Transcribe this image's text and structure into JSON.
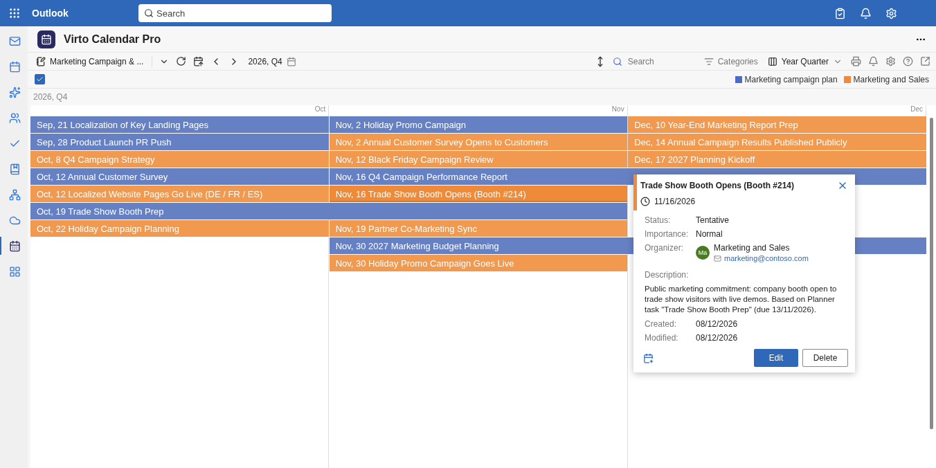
{
  "topbar": {
    "app_name": "Outlook",
    "search": {
      "placeholder": "Search"
    }
  },
  "rail": [
    {
      "selected": false
    },
    {
      "selected": false
    },
    {
      "selected": false
    },
    {
      "selected": false
    },
    {
      "selected": false
    },
    {
      "selected": false
    },
    {
      "selected": false
    },
    {
      "selected": false
    },
    {
      "selected": true
    },
    {
      "selected": false
    }
  ],
  "app": {
    "title": "Virto Calendar Pro"
  },
  "toolbar": {
    "calendar_name": "Marketing Campaign & ...",
    "period": "2026, Q4",
    "search": {
      "placeholder": "Search"
    },
    "categories": "Categories",
    "view": "Year Quarter"
  },
  "select_all": {
    "checked": true
  },
  "legend": [
    {
      "label": "Marketing campaign plan",
      "color": "#4a6cc4"
    },
    {
      "label": "Marketing and Sales",
      "color": "#f08a3a"
    }
  ],
  "period_label": "2026, Q4",
  "months": [
    "Oct",
    "Nov",
    "Dec"
  ],
  "rows": [
    {
      "events": [
        {
          "kind": "single",
          "label": "Sep, 21 Localization of Key Landing Pages",
          "color": "#6680c4",
          "selected": false
        },
        {
          "kind": "single",
          "label": "Nov, 2 Holiday Promo Campaign",
          "color": "#6680c4",
          "selected": false
        },
        {
          "kind": "single",
          "label": "Dec, 10 Year-End Marketing Report Prep",
          "color": "#f0994f",
          "selected": false
        }
      ]
    },
    {
      "events": [
        {
          "kind": "single",
          "label": "Sep, 28 Product Launch PR Push",
          "color": "#6680c4",
          "selected": false
        },
        {
          "kind": "single",
          "label": "Nov, 2 Annual Customer Survey Opens to Customers",
          "color": "#f0994f",
          "selected": false
        },
        {
          "kind": "single",
          "label": "Dec, 14 Annual Campaign Results Published Publicly",
          "color": "#f0994f",
          "selected": false
        }
      ]
    },
    {
      "events": [
        {
          "kind": "single",
          "label": "Oct, 8 Q4 Campaign Strategy",
          "color": "#f0994f",
          "selected": false
        },
        {
          "kind": "single",
          "label": "Nov, 12 Black Friday Campaign Review",
          "color": "#f0994f",
          "selected": false
        },
        {
          "kind": "single",
          "label": "Dec, 17 2027 Planning Kickoff",
          "color": "#f0994f",
          "selected": false
        }
      ]
    },
    {
      "events": [
        {
          "kind": "single",
          "label": "Oct, 12 Annual Customer Survey",
          "color": "#6680c4",
          "selected": false
        },
        {
          "kind": "double",
          "label": "Nov, 16 Q4 Campaign Performance Report",
          "color": "#6680c4",
          "selected": false
        }
      ]
    },
    {
      "events": [
        {
          "kind": "single",
          "label": "Oct, 12 Localized Website Pages Go Live (DE / FR / ES)",
          "color": "#f0994f",
          "selected": false
        },
        {
          "kind": "single",
          "label": "Nov, 16 Trade Show Booth Opens (Booth #214)",
          "color": "#ee8a38",
          "selected": true
        }
      ]
    },
    {
      "events": [
        {
          "kind": "double",
          "label": "Oct, 19 Trade Show Booth Prep",
          "color": "#6680c4",
          "selected": false
        }
      ]
    },
    {
      "events": [
        {
          "kind": "single",
          "label": "Oct, 22 Holiday Campaign Planning",
          "color": "#f0994f",
          "selected": false
        },
        {
          "kind": "single",
          "label": "Nov, 19 Partner Co-Marketing Sync",
          "color": "#f0994f",
          "selected": false
        }
      ]
    },
    {
      "events": [
        {
          "kind": "gap"
        },
        {
          "kind": "double",
          "label": "Nov, 30 2027 Marketing Budget Planning",
          "color": "#6680c4",
          "selected": false
        }
      ]
    },
    {
      "events": [
        {
          "kind": "gap"
        },
        {
          "kind": "single",
          "label": "Nov, 30 Holiday Promo Campaign Goes Live",
          "color": "#f0994f",
          "selected": false
        }
      ]
    }
  ],
  "popup": {
    "title": "Trade Show Booth Opens (Booth #214)",
    "color": "#f08a3a",
    "date": "11/16/2026",
    "fields": [
      {
        "label": "Status:",
        "value": "Tentative"
      },
      {
        "label": "Importance:",
        "value": "Normal"
      }
    ],
    "organizer": {
      "label": "Organizer:",
      "initials": "Ma",
      "name": "Marketing and Sales",
      "email": "marketing@contoso.com"
    },
    "description_label": "Description:",
    "description": "Public marketing commitment: company booth open to trade show visitors with live demos. Based on Planner task \"Trade Show Booth Prep\" (due 13/11/2026).",
    "dates": [
      {
        "label": "Created:",
        "value": "08/12/2026"
      },
      {
        "label": "Modified:",
        "value": "08/12/2026"
      }
    ],
    "buttons": {
      "edit": "Edit",
      "delete": "Delete"
    }
  }
}
